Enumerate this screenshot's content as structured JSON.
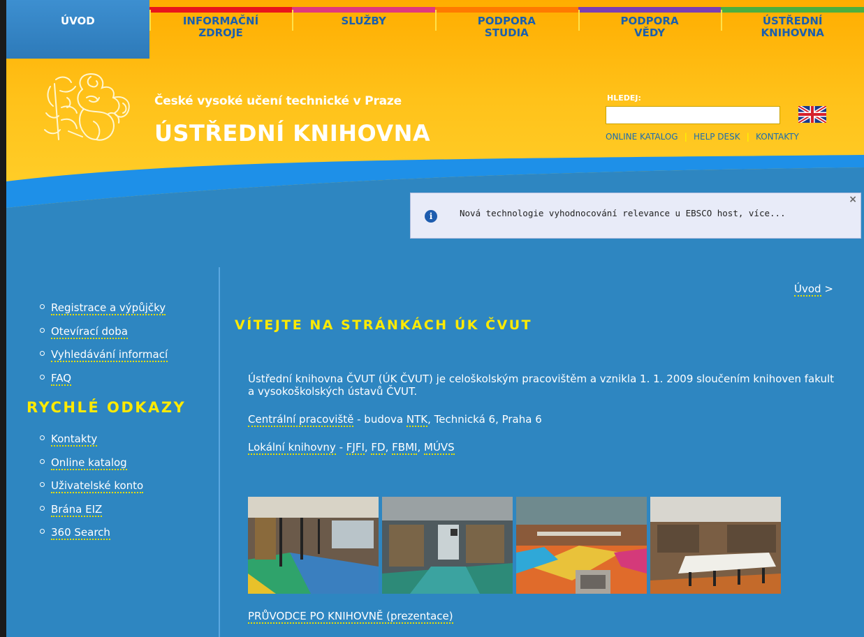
{
  "nav": {
    "items": [
      {
        "label": "ÚVOD",
        "color": "#2f80c2"
      },
      {
        "label": "INFORMAČNÍ\nZDROJE",
        "color": "#e8151b"
      },
      {
        "label": "SLUŽBY",
        "color": "#e0397e"
      },
      {
        "label": "PODPORA\nSTUDIA",
        "color": "#ff7a00"
      },
      {
        "label": "PODPORA\nVĚDY",
        "color": "#7c3eb3"
      },
      {
        "label": "ÚSTŘEDNÍ\nKNIHOVNA",
        "color": "#4caf3f"
      }
    ]
  },
  "header": {
    "subtitle": "České vysoké učení technické v Praze",
    "title": "ÚSTŘEDNÍ KNIHOVNA",
    "logo_icon": "lion-emblem-icon"
  },
  "search": {
    "label": "HLEDEJ:",
    "value": "",
    "placeholder": "",
    "language_icon": "uk-flag-icon"
  },
  "quick_links": [
    "ONLINE KATALOG",
    "HELP DESK",
    "KONTAKTY"
  ],
  "notice": {
    "icon": "info-icon",
    "text": "Nová technologie vyhodnocování relevance u EBSCO host, více...",
    "close": "×"
  },
  "sidebar": {
    "main_links": [
      "Registrace a výpůjčky",
      "Otevírací doba",
      "Vyhledávání informací",
      "FAQ"
    ],
    "heading": "RYCHLÉ ODKAZY",
    "quick_links": [
      "Kontakty",
      "Online katalog",
      "Uživatelské konto",
      "Brána EIZ",
      "360 Search"
    ]
  },
  "breadcrumb": {
    "link": "Úvod",
    "sep": " >"
  },
  "main": {
    "title": "VÍTEJTE NA STRÁNKÁCH ÚK ČVUT",
    "intro": "Ústřední knihovna ČVUT (ÚK ČVUT) je celoškolským pracovištěm a vznikla 1. 1. 2009 sloučením knihoven fakult a vysokoškolských ústavů ČVUT.",
    "central_link": "Centrální pracoviště",
    "central_text": " -  budova ",
    "central_ntk": "NTK",
    "central_address": ", Technická 6, Praha 6",
    "local_link": "Lokální knihovny",
    "local_sep": " - ",
    "local_items": [
      "FJFI",
      "FD",
      "FBMI",
      "MÚVS"
    ],
    "guide_link": "PRŮVODCE PO KNIHOVNĚ (prezentace)"
  },
  "colors": {
    "background": "#2e86c1",
    "header_yellow": "#ffc21a",
    "accent_yellow": "#ffea00",
    "nav_text": "#1a5fae"
  }
}
